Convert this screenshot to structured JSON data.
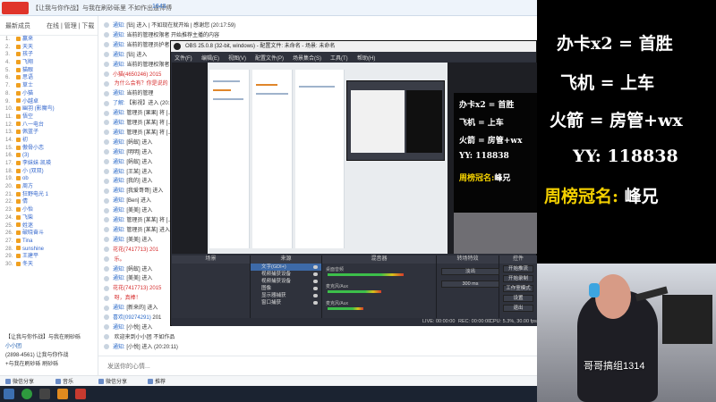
{
  "app": {
    "logo": "",
    "title": "【让我与你作战】与我在刷砂砾里 不如作出道师傅",
    "online": "1643"
  },
  "members": {
    "head_left": "最新成员",
    "head_right": "在线 | 管理 | 下载",
    "items": [
      {
        "num": "1.",
        "name": "赢来"
      },
      {
        "num": "2.",
        "name": "天天"
      },
      {
        "num": "3.",
        "name": "孩子"
      },
      {
        "num": "4.",
        "name": "飞翔"
      },
      {
        "num": "5.",
        "name": "猫眼"
      },
      {
        "num": "6.",
        "name": "思语"
      },
      {
        "num": "7.",
        "name": "草士"
      },
      {
        "num": "8.",
        "name": "小猫"
      },
      {
        "num": "9.",
        "name": "小越卓"
      },
      {
        "num": "10.",
        "name": "幽羽 (影魔鸟)"
      },
      {
        "num": "11.",
        "name": "悟空"
      },
      {
        "num": "12.",
        "name": "八一电台"
      },
      {
        "num": "13.",
        "name": "佩蓝子"
      },
      {
        "num": "14.",
        "name": "初"
      },
      {
        "num": "15.",
        "name": "傲骨小恋"
      },
      {
        "num": "16.",
        "name": "(3)"
      },
      {
        "num": "17.",
        "name": "李妹妹·凯瑛"
      },
      {
        "num": "18.",
        "name": "小 (双双)"
      },
      {
        "num": "19.",
        "name": "ob"
      },
      {
        "num": "20.",
        "name": "周方"
      },
      {
        "num": "21.",
        "name": "狂野电光 1"
      },
      {
        "num": "22.",
        "name": "倩"
      },
      {
        "num": "23.",
        "name": "小怡"
      },
      {
        "num": "24.",
        "name": "飞柴"
      },
      {
        "num": "25.",
        "name": "姓迷"
      },
      {
        "num": "26.",
        "name": "破晓奋斗"
      },
      {
        "num": "27.",
        "name": "Tina"
      },
      {
        "num": "28.",
        "name": "sunshine"
      },
      {
        "num": "29.",
        "name": "王建平"
      },
      {
        "num": "30.",
        "name": "冬天"
      }
    ]
  },
  "groups": [
    {
      "label": "【让我与你作战】与我在刷砂砾"
    },
    {
      "label": "小小团",
      "blue": true
    },
    {
      "label": "(2898-4561)  让我与你作战"
    },
    {
      "label": "+与我在刷砂砾 刷砂砾"
    }
  ],
  "chat": {
    "messages": [
      {
        "user": "通知:",
        "text": "[钻] 进入 | 不如现在就开始 | 感谢您 (20:17:59)"
      },
      {
        "user": "通知:",
        "text": "当前的管理权限者 开始推荐主播的内容"
      },
      {
        "user": "通知:",
        "text": "当前的管理员护者【房管】"
      },
      {
        "user": "通知:",
        "text": "[钻] 进入"
      },
      {
        "user": "通知:",
        "text": "当前的管理权限者 开始"
      },
      {
        "user": "小猫(4650246)",
        "text": "2015",
        "red": true
      },
      {
        "user": "",
        "text": "为什么会有？你是说的",
        "red": true
      },
      {
        "user": "通知:",
        "text": "当前的管理"
      },
      {
        "user": "了解:",
        "text": "【影视】进入 (20:18)"
      },
      {
        "user": "通知:",
        "text": "管理员 [果果] 将 [...]"
      },
      {
        "user": "通知:",
        "text": "管理员 [某某] 将 [...]"
      },
      {
        "user": "通知:",
        "text": "管理员 [某某] 将 [...]"
      },
      {
        "user": "通知:",
        "text": "[蚂蚁] 进入"
      },
      {
        "user": "通知:",
        "text": "[明明] 进入"
      },
      {
        "user": "通知:",
        "text": "[蚂蚁] 进入"
      },
      {
        "user": "通知:",
        "text": "[王某] 进入"
      },
      {
        "user": "通知:",
        "text": "[我的] 进入"
      },
      {
        "user": "通知:",
        "text": "[我爱哥哥] 进入"
      },
      {
        "user": "通知:",
        "text": "[Ben] 进入"
      },
      {
        "user": "通知:",
        "text": "[美美] 进入"
      },
      {
        "user": "通知:",
        "text": "管理员 [某某] 将 [...]"
      },
      {
        "user": "通知:",
        "text": "管理员 [某某] 进入"
      },
      {
        "user": "通知:",
        "text": "[美美] 进入"
      },
      {
        "user": "花花(7417713)",
        "text": "201",
        "red": true
      },
      {
        "user": "",
        "text": "乐。",
        "red": true
      },
      {
        "user": "通知:",
        "text": "[蚂蚁] 进入"
      },
      {
        "user": "通知:",
        "text": "[美美] 进入"
      },
      {
        "user": "花花(7417713)",
        "text": "2015",
        "red": true
      },
      {
        "user": "",
        "text": "呀，真棒！",
        "red": true
      },
      {
        "user": "通知:",
        "text": "[新来的] 进入"
      },
      {
        "user": "喜欢(09274291)",
        "text": "201"
      },
      {
        "user": "通知:",
        "text": "[小悦] 进入"
      },
      {
        "user": "",
        "text": "欢迎来到小小团 不如作品"
      },
      {
        "user": "通知:",
        "text": "[小悦] 进入 (20:20:11)"
      }
    ],
    "input_placeholder": "发送你的心情..."
  },
  "tabs": [
    {
      "label": "微信分享"
    },
    {
      "label": "音乐"
    },
    {
      "label": "微信分享"
    },
    {
      "label": "推荐"
    }
  ],
  "obs": {
    "title": "OBS 25.0.8 (32-bit, windows) - 配置文件: 未命名 - 场景: 未命名",
    "menu": [
      "文件(F)",
      "编辑(E)",
      "视图(V)",
      "配置文件(P)",
      "场景集合(S)",
      "工具(T)",
      "帮助(H)"
    ],
    "docks": {
      "scenes": "场景",
      "sources": "来源",
      "mixer": "混音器",
      "transitions": "转场特效",
      "controls": "控件"
    },
    "sources": [
      {
        "label": "文字(GDI+)",
        "selected": true
      },
      {
        "label": "视频捕获设备"
      },
      {
        "label": "视频捕获设备"
      },
      {
        "label": "图像"
      },
      {
        "label": "显示器捕获"
      },
      {
        "label": "窗口捕获"
      }
    ],
    "mixer": [
      {
        "label": "桌面音频",
        "level": 0.85
      },
      {
        "label": "麦克风/Aux",
        "level": 0.6
      },
      {
        "label": "麦克风/Aux",
        "level": 0.4
      }
    ],
    "transition": "淡出",
    "duration": "300 ms",
    "controls": [
      "开始推流",
      "开始录制",
      "工作室模式",
      "设置",
      "退出"
    ],
    "status": {
      "live": "LIVE: 00:00:00",
      "rec": "REC: 00:00:00",
      "cpu": "CPU: 5.3%, 30.00 fps"
    },
    "overlay": [
      "办卡x2 = 首胜",
      "飞机 = 上车",
      "火箭 = 房管+wx",
      "YY: 118838"
    ],
    "overlay_rank_label": "周榜冠名:",
    "overlay_rank_name": "峰兄"
  },
  "right_overlay": {
    "lines": [
      "办卡x2 = 首胜",
      "飞机 = 上车",
      "火箭 = 房管+wx",
      "YY: 118838"
    ],
    "rank_label": "周榜冠名:",
    "rank_name": "峰兄",
    "watermark": "哥哥搞组1314"
  },
  "colors": {
    "accent": "#3a7bd5",
    "overlay_yellow": "#f4d000",
    "alert_red": "#d62d2d",
    "obs_dark": "#2b2e38"
  }
}
